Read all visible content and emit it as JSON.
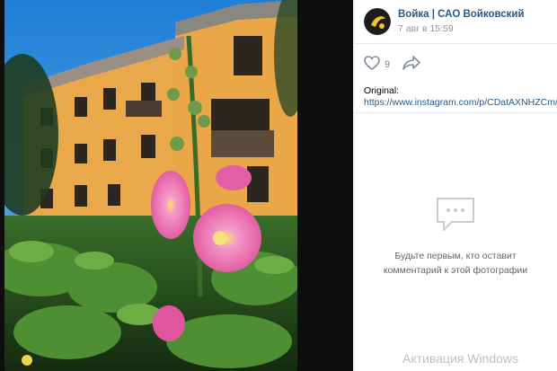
{
  "post": {
    "author": "Войка | САО Войковский",
    "date": "7 авг в 15:59",
    "likes": "9",
    "description_label": "Original:",
    "description_link": "https://www.instagram.com/p/CDatAXNHZCm/"
  },
  "comments": {
    "empty_text": "Будьте первым, кто оставит комментарий к этой фотографии"
  },
  "watermark": "Активация Windows",
  "icons": {
    "like": "heart-icon",
    "share": "share-arrow-icon",
    "empty_comments": "speech-bubble-icon"
  },
  "colors": {
    "link": "#2a5885",
    "muted": "#939393"
  }
}
